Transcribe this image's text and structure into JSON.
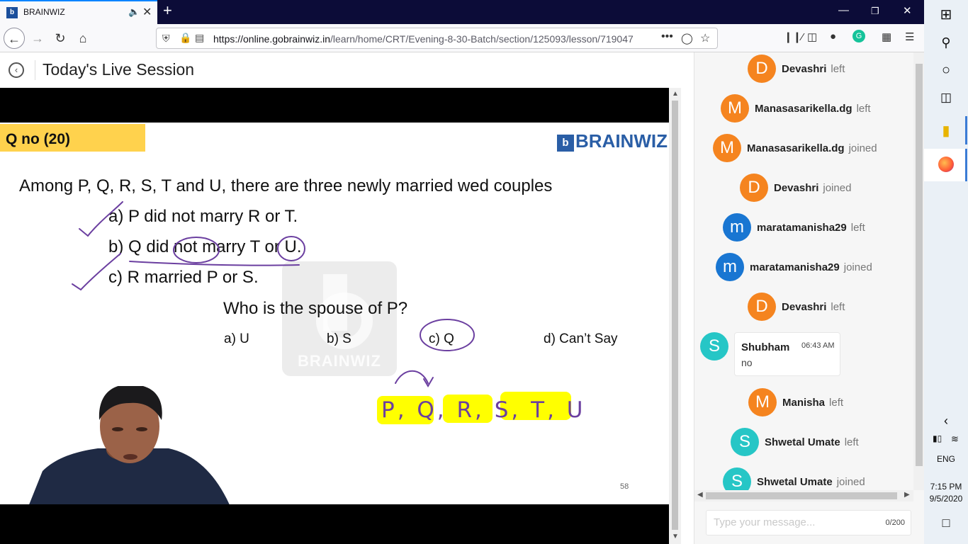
{
  "browser": {
    "tab_title": "BRAINWIZ",
    "tab_favicon": "b",
    "url_host": "https://online.gobrainwiz.in",
    "url_path": "/learn/home/CRT/Evening-8-30-Batch/section/125093/lesson/719047",
    "icons": [
      "back-icon",
      "forward-icon",
      "reload-icon",
      "home-icon",
      "shield-icon",
      "lock-icon",
      "reader-icon",
      "more-icon",
      "pocket-icon",
      "star-icon",
      "library-icon",
      "sidebar-icon",
      "account-icon",
      "grammarly-icon",
      "extensions-icon",
      "menu-icon"
    ],
    "accent": "#0a84ff"
  },
  "page": {
    "title": "Today's Live Session"
  },
  "slide": {
    "badge": "Q no (20)",
    "brand": "BRAINWIZ",
    "brand_mark": "b",
    "statement": "Among P, Q, R, S, T and U, there are three newly married wed couples",
    "clue_a": "a)   P did not marry R or T.",
    "clue_b": "b)  Q did not marry T or U.",
    "clue_c": "c)   R married P or S.",
    "question": "Who is the spouse of P?",
    "options": [
      "a) U",
      "b) S",
      "c) Q",
      "d) Can’t Say"
    ],
    "watermark": "BRAINWIZ",
    "page_number": "58",
    "handwriting": "P, Q, R, S, T, U",
    "highlight_color": "#ffff00",
    "ink_color": "#6b3fa0"
  },
  "chat": {
    "events": [
      {
        "initial": "D",
        "name": "Devashri",
        "action": "left",
        "color": "#f5841f"
      },
      {
        "initial": "M",
        "name": "Manasasarikella.dg",
        "action": "left",
        "color": "#f5841f"
      },
      {
        "initial": "M",
        "name": "Manasasarikella.dg",
        "action": "joined",
        "color": "#f5841f"
      },
      {
        "initial": "D",
        "name": "Devashri",
        "action": "joined",
        "color": "#f5841f"
      },
      {
        "initial": "m",
        "name": "maratamanisha29",
        "action": "left",
        "color": "#1976d2"
      },
      {
        "initial": "m",
        "name": "maratamanisha29",
        "action": "joined",
        "color": "#1976d2"
      },
      {
        "initial": "D",
        "name": "Devashri",
        "action": "left",
        "color": "#f5841f"
      },
      {
        "initial": "M",
        "name": "Manisha",
        "action": "left",
        "color": "#f5841f"
      },
      {
        "initial": "S",
        "name": "Shwetal Umate",
        "action": "left",
        "color": "#26c6c6"
      },
      {
        "initial": "S",
        "name": "Shwetal Umate",
        "action": "joined",
        "color": "#26c6c6"
      }
    ],
    "message": {
      "initial": "S",
      "name": "Shubham",
      "time": "06:43 AM",
      "text": "no",
      "color": "#26c6c6"
    },
    "input_placeholder": "Type your message...",
    "char_count": "0/200"
  },
  "taskbar": {
    "language": "ENG",
    "time": "7:15 PM",
    "date": "9/5/2020",
    "icons": [
      "windows-start-icon",
      "search-icon",
      "cortana-icon",
      "task-view-icon",
      "file-explorer-icon",
      "firefox-icon",
      "chevron-left-icon",
      "battery-icon",
      "wifi-icon",
      "notification-icon"
    ]
  }
}
